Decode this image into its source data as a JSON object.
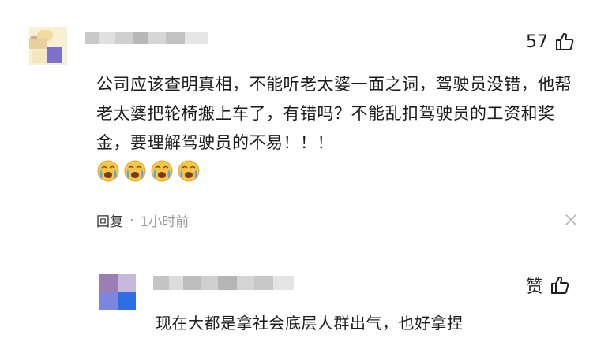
{
  "comment": {
    "like_count": "57",
    "text": "公司应该查明真相，不能听老太婆一面之词，驾驶员没错，他帮老太婆把轮椅搬上车了，有错吗？不能乱扣驾驶员的工资和奖金，要理解驾驶员的不易！！！",
    "emojis": [
      "crying-emoji",
      "crying-emoji",
      "crying-emoji",
      "crying-emoji"
    ],
    "reply_label": "回复",
    "separator": "·",
    "time": "1小时前"
  },
  "reply": {
    "like_label": "赞",
    "text": "现在大都是拿社会底层人群出气，也好拿捏"
  },
  "colors": {
    "text": "#1b1b1b",
    "muted": "#999999",
    "avatar1": [
      "#f3e6b4",
      "#e8d0a8",
      "#7b73c9",
      "#f6efcf"
    ],
    "avatar2": [
      "#9b7fb4",
      "#c7b5da",
      "#7a86e0",
      "#2f6de3"
    ]
  },
  "icons": [
    "thumbs-up-icon",
    "close-icon",
    "crying-emoji"
  ]
}
